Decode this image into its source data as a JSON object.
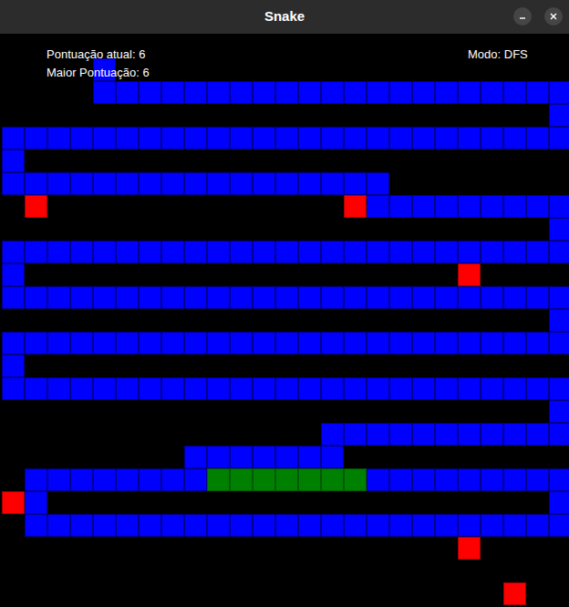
{
  "window": {
    "title": "Snake"
  },
  "hud": {
    "score_label": "Pontuação atual: 6",
    "best_label": "Maior Pontuação: 6",
    "mode_label": "Modo: DFS"
  },
  "board": {
    "segments": [
      {
        "kind": "snake",
        "row": 1,
        "from": 4,
        "to": 4
      },
      {
        "kind": "snake",
        "row": 2,
        "from": 4,
        "to": 24
      },
      {
        "kind": "snake",
        "row": 3,
        "from": 24,
        "to": 24
      },
      {
        "kind": "snake",
        "row": 4,
        "from": 0,
        "to": 24
      },
      {
        "kind": "snake",
        "row": 5,
        "from": 0,
        "to": 0
      },
      {
        "kind": "snake",
        "row": 6,
        "from": 0,
        "to": 16
      },
      {
        "kind": "snake",
        "row": 7,
        "from": 16,
        "to": 24
      },
      {
        "kind": "snake",
        "row": 8,
        "from": 24,
        "to": 24
      },
      {
        "kind": "snake",
        "row": 9,
        "from": 0,
        "to": 24
      },
      {
        "kind": "snake",
        "row": 10,
        "from": 0,
        "to": 0
      },
      {
        "kind": "snake",
        "row": 11,
        "from": 0,
        "to": 24
      },
      {
        "kind": "snake",
        "row": 12,
        "from": 24,
        "to": 24
      },
      {
        "kind": "snake",
        "row": 13,
        "from": 0,
        "to": 24
      },
      {
        "kind": "snake",
        "row": 14,
        "from": 0,
        "to": 0
      },
      {
        "kind": "snake",
        "row": 15,
        "from": 0,
        "to": 24
      },
      {
        "kind": "snake",
        "row": 16,
        "from": 24,
        "to": 24
      },
      {
        "kind": "snake",
        "row": 17,
        "from": 14,
        "to": 24
      },
      {
        "kind": "snake",
        "row": 18,
        "from": 8,
        "to": 14
      },
      {
        "kind": "snake",
        "row": 19,
        "from": 1,
        "to": 8
      },
      {
        "kind": "path",
        "row": 19,
        "from": 9,
        "to": 15
      },
      {
        "kind": "snake",
        "row": 19,
        "from": 16,
        "to": 24
      },
      {
        "kind": "snake",
        "row": 20,
        "from": 1,
        "to": 1
      },
      {
        "kind": "snake",
        "row": 20,
        "from": 24,
        "to": 24
      },
      {
        "kind": "snake",
        "row": 21,
        "from": 1,
        "to": 24
      },
      {
        "kind": "food",
        "row": 7,
        "from": 1,
        "to": 1
      },
      {
        "kind": "food",
        "row": 7,
        "from": 15,
        "to": 15
      },
      {
        "kind": "food",
        "row": 10,
        "from": 20,
        "to": 20
      },
      {
        "kind": "food",
        "row": 20,
        "from": 0,
        "to": 0
      },
      {
        "kind": "food",
        "row": 22,
        "from": 20,
        "to": 20
      },
      {
        "kind": "food",
        "row": 24,
        "from": 22,
        "to": 22
      }
    ]
  }
}
